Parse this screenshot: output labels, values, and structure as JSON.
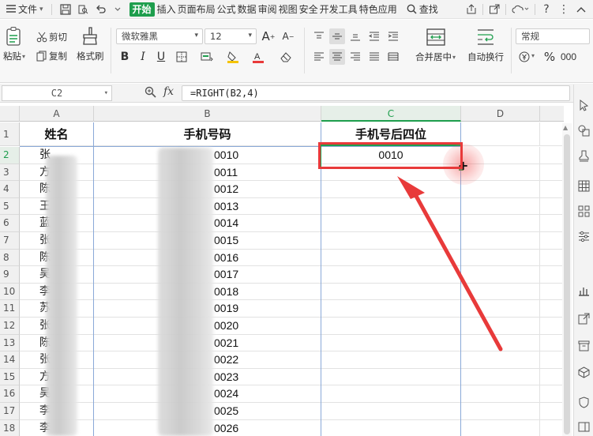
{
  "menubar": {
    "file_label": "文件",
    "tabs": [
      "开始",
      "插入",
      "页面布局",
      "公式",
      "数据",
      "审阅",
      "视图",
      "安全",
      "开发工具",
      "特色应用"
    ],
    "active_tab": "开始",
    "search_label": "查找"
  },
  "ribbon": {
    "paste_label": "粘贴",
    "cut_label": "剪切",
    "copy_label": "复制",
    "format_painter_label": "格式刷",
    "font_name": "微软雅黑",
    "font_size": "12",
    "merge_center_label": "合并居中",
    "wrap_text_label": "自动换行",
    "number_format": "常规"
  },
  "formula_bar": {
    "cell_ref": "C2",
    "fx_label": "fx",
    "formula": "=RIGHT(B2,4)"
  },
  "sheet": {
    "columns": [
      "A",
      "B",
      "C",
      "D"
    ],
    "selected_column": "C",
    "selected_row": "2",
    "headers": {
      "a": "姓名",
      "b": "手机号码",
      "c": "手机号后四位"
    },
    "rows": [
      {
        "num": "2",
        "name": "张",
        "phone_tail": "0010",
        "c": "0010"
      },
      {
        "num": "3",
        "name": "方",
        "phone_tail": "0011",
        "c": ""
      },
      {
        "num": "4",
        "name": "陈",
        "phone_tail": "0012",
        "c": ""
      },
      {
        "num": "5",
        "name": "王",
        "phone_tail": "0013",
        "c": ""
      },
      {
        "num": "6",
        "name": "蓝",
        "phone_tail": "0014",
        "c": ""
      },
      {
        "num": "7",
        "name": "张",
        "phone_tail": "0015",
        "c": ""
      },
      {
        "num": "8",
        "name": "陈",
        "phone_tail": "0016",
        "c": ""
      },
      {
        "num": "9",
        "name": "吴",
        "phone_tail": "0017",
        "c": ""
      },
      {
        "num": "10",
        "name": "李",
        "phone_tail": "0018",
        "c": ""
      },
      {
        "num": "11",
        "name": "苏",
        "phone_tail": "0019",
        "c": ""
      },
      {
        "num": "12",
        "name": "张",
        "phone_tail": "0020",
        "c": ""
      },
      {
        "num": "13",
        "name": "陈",
        "phone_tail": "0021",
        "c": ""
      },
      {
        "num": "14",
        "name": "张",
        "phone_tail": "0022",
        "c": ""
      },
      {
        "num": "15",
        "name": "方",
        "phone_tail": "0023",
        "c": ""
      },
      {
        "num": "16",
        "name": "吴",
        "phone_tail": "0024",
        "c": ""
      },
      {
        "num": "17",
        "name": "李",
        "phone_tail": "0025",
        "c": ""
      },
      {
        "num": "18",
        "name": "李",
        "phone_tail": "0026",
        "c": ""
      }
    ]
  },
  "annotation": {
    "color": "#e83a3a"
  }
}
